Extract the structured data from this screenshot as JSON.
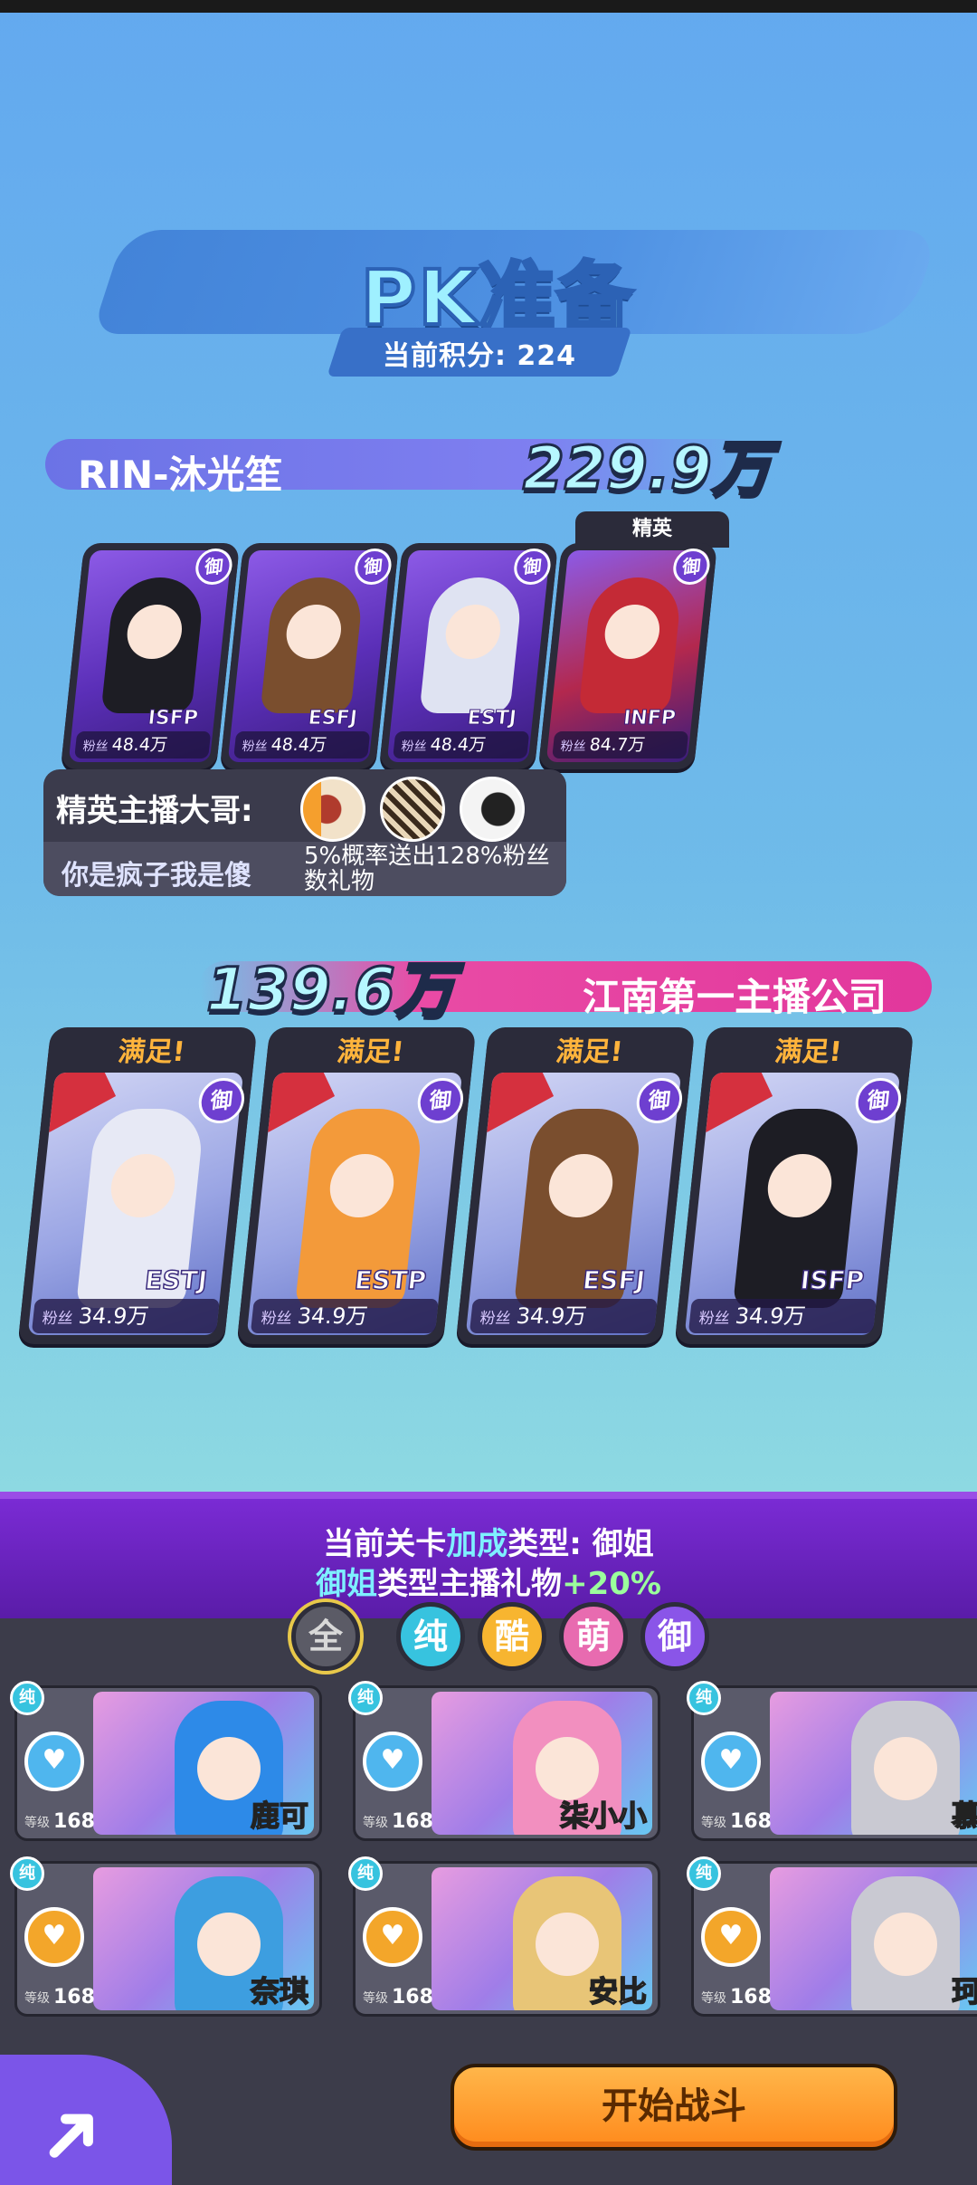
{
  "title": "PK准备",
  "score": "当前积分: 224",
  "team1": {
    "name": "RIN-沐光笙",
    "total": "229.9万",
    "elite_label": "精英",
    "cards": [
      {
        "mbti": "ISFP",
        "fans_label": "粉丝",
        "fans": "48.4万",
        "badge": "御"
      },
      {
        "mbti": "ESFJ",
        "fans_label": "粉丝",
        "fans": "48.4万",
        "badge": "御"
      },
      {
        "mbti": "ESTJ",
        "fans_label": "粉丝",
        "fans": "48.4万",
        "badge": "御"
      },
      {
        "mbti": "INFP",
        "fans_label": "粉丝",
        "fans": "84.7万",
        "badge": "御"
      }
    ]
  },
  "elite": {
    "label": "精英主播大哥:",
    "user": "你是疯子我是傻",
    "desc": "5%概率送出128%粉丝数礼物"
  },
  "team2": {
    "name": "江南第一主播公司",
    "total": "139.6万",
    "cards": [
      {
        "status": "满足!",
        "mbti": "ESTJ",
        "fans_label": "粉丝",
        "fans": "34.9万",
        "badge": "御"
      },
      {
        "status": "满足!",
        "mbti": "ESTP",
        "fans_label": "粉丝",
        "fans": "34.9万",
        "badge": "御"
      },
      {
        "status": "满足!",
        "mbti": "ESFJ",
        "fans_label": "粉丝",
        "fans": "34.9万",
        "badge": "御"
      },
      {
        "status": "满足!",
        "mbti": "ISFP",
        "fans_label": "粉丝",
        "fans": "34.9万",
        "badge": "御"
      }
    ]
  },
  "bonus": {
    "line1_a": "当前关卡",
    "line1_b": "加成",
    "line1_c": "类型: 御姐",
    "line2_a": "御姐",
    "line2_b": "类型主播礼物",
    "line2_c": "+20%"
  },
  "filters": [
    "全",
    "纯",
    "酷",
    "萌",
    "御"
  ],
  "streamers": [
    {
      "tag": "纯",
      "level_label": "等级",
      "level": "168",
      "name": "鹿可",
      "heart": "blue"
    },
    {
      "tag": "纯",
      "level_label": "等级",
      "level": "168",
      "name": "柒小小",
      "heart": "blue"
    },
    {
      "tag": "纯",
      "level_label": "等级",
      "level": "168",
      "name": "慕",
      "heart": "blue"
    },
    {
      "tag": "纯",
      "level_label": "等级",
      "level": "168",
      "name": "奈琪",
      "heart": "gold"
    },
    {
      "tag": "纯",
      "level_label": "等级",
      "level": "168",
      "name": "安比",
      "heart": "gold"
    },
    {
      "tag": "纯",
      "level_label": "等级",
      "level": "168",
      "name": "珂",
      "heart": "gold"
    }
  ],
  "start_button": "开始战斗",
  "colors": {
    "accent": "#7b55e8",
    "start": "#ff9a2a",
    "team2": "#e2379c"
  }
}
